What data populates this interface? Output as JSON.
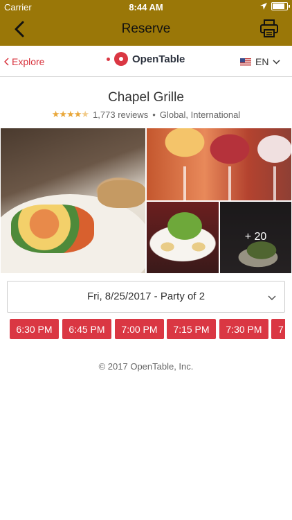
{
  "status_bar": {
    "carrier": "Carrier",
    "time": "8:44 AM"
  },
  "nav": {
    "title": "Reserve",
    "back_icon": "chevron-left-icon",
    "print_icon": "printer-icon"
  },
  "header": {
    "explore_label": "Explore",
    "logo_text": "OpenTable",
    "language": "EN"
  },
  "restaurant": {
    "name": "Chapel Grille",
    "rating": 4.5,
    "reviews": "1,773 reviews",
    "location": "Global, International",
    "more_photos": "+ 20"
  },
  "reservation": {
    "date_party": "Fri, 8/25/2017 - Party of 2",
    "times": [
      "6:30 PM",
      "6:45 PM",
      "7:00 PM",
      "7:15 PM",
      "7:30 PM",
      "7"
    ]
  },
  "footer": {
    "copyright": "© 2017 OpenTable, Inc."
  },
  "colors": {
    "nav_bar": "#9a7708",
    "accent": "#da3743",
    "star": "#e9a73a"
  }
}
